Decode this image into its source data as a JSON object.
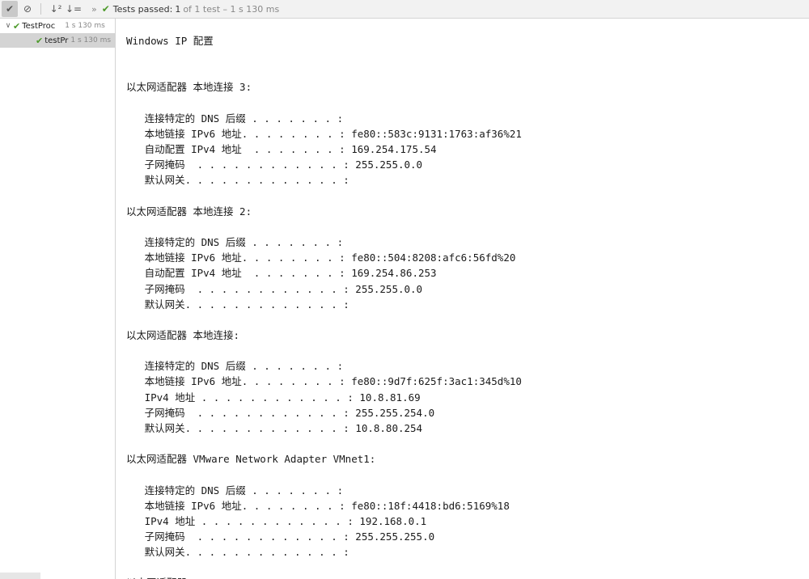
{
  "toolbar": {
    "buttons": [
      {
        "icon": "check-icon",
        "glyph": "✔"
      },
      {
        "icon": "stop-icon",
        "glyph": "⊘"
      },
      {
        "icon": "sort-alpha-icon",
        "glyph": "↓²"
      },
      {
        "icon": "sort-duration-icon",
        "glyph": "↓="
      }
    ],
    "more": "»",
    "status": {
      "label": "Tests passed:",
      "count": "1",
      "detail": "of 1 test – 1 s 130 ms"
    }
  },
  "tree": {
    "items": [
      {
        "arrow": "∨",
        "name": "TestProc",
        "time": "1 s 130 ms"
      },
      {
        "name": "testPr",
        "time": "1 s 130 ms"
      }
    ]
  },
  "console": {
    "lines": [
      "Windows IP 配置",
      "",
      "",
      "以太网适配器 本地连接 3:",
      "",
      "   连接特定的 DNS 后缀 . . . . . . . :",
      "   本地链接 IPv6 地址. . . . . . . . : fe80::583c:9131:1763:af36%21",
      "   自动配置 IPv4 地址  . . . . . . . : 169.254.175.54",
      "   子网掩码  . . . . . . . . . . . . : 255.255.0.0",
      "   默认网关. . . . . . . . . . . . . :",
      "",
      "以太网适配器 本地连接 2:",
      "",
      "   连接特定的 DNS 后缀 . . . . . . . :",
      "   本地链接 IPv6 地址. . . . . . . . : fe80::504:8208:afc6:56fd%20",
      "   自动配置 IPv4 地址  . . . . . . . : 169.254.86.253",
      "   子网掩码  . . . . . . . . . . . . : 255.255.0.0",
      "   默认网关. . . . . . . . . . . . . :",
      "",
      "以太网适配器 本地连接:",
      "",
      "   连接特定的 DNS 后缀 . . . . . . . :",
      "   本地链接 IPv6 地址. . . . . . . . : fe80::9d7f:625f:3ac1:345d%10",
      "   IPv4 地址 . . . . . . . . . . . . : 10.8.81.69",
      "   子网掩码  . . . . . . . . . . . . : 255.255.254.0",
      "   默认网关. . . . . . . . . . . . . : 10.8.80.254",
      "",
      "以太网适配器 VMware Network Adapter VMnet1:",
      "",
      "   连接特定的 DNS 后缀 . . . . . . . :",
      "   本地链接 IPv6 地址. . . . . . . . : fe80::18f:4418:bd6:5169%18",
      "   IPv4 地址 . . . . . . . . . . . . : 192.168.0.1",
      "   子网掩码  . . . . . . . . . . . . : 255.255.255.0",
      "   默认网关. . . . . . . . . . . . . :",
      "",
      "以太网适配器"
    ]
  }
}
